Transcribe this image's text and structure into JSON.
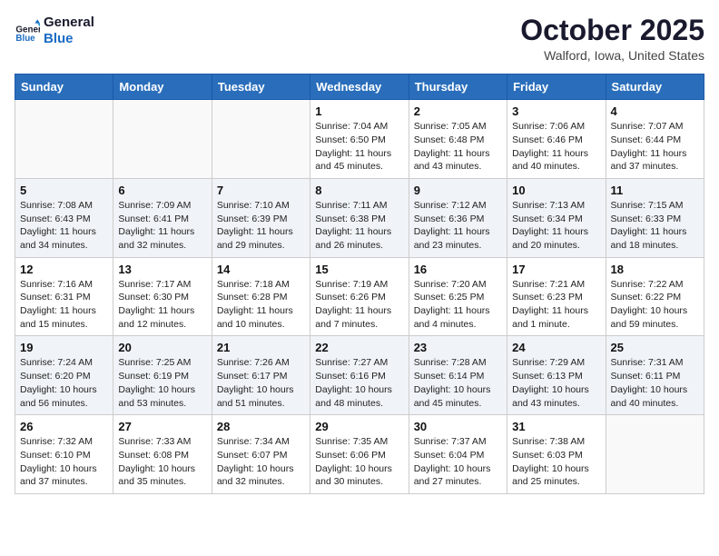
{
  "header": {
    "logo_line1": "General",
    "logo_line2": "Blue",
    "month": "October 2025",
    "location": "Walford, Iowa, United States"
  },
  "weekdays": [
    "Sunday",
    "Monday",
    "Tuesday",
    "Wednesday",
    "Thursday",
    "Friday",
    "Saturday"
  ],
  "weeks": [
    [
      {
        "day": "",
        "info": ""
      },
      {
        "day": "",
        "info": ""
      },
      {
        "day": "",
        "info": ""
      },
      {
        "day": "1",
        "info": "Sunrise: 7:04 AM\nSunset: 6:50 PM\nDaylight: 11 hours and 45 minutes."
      },
      {
        "day": "2",
        "info": "Sunrise: 7:05 AM\nSunset: 6:48 PM\nDaylight: 11 hours and 43 minutes."
      },
      {
        "day": "3",
        "info": "Sunrise: 7:06 AM\nSunset: 6:46 PM\nDaylight: 11 hours and 40 minutes."
      },
      {
        "day": "4",
        "info": "Sunrise: 7:07 AM\nSunset: 6:44 PM\nDaylight: 11 hours and 37 minutes."
      }
    ],
    [
      {
        "day": "5",
        "info": "Sunrise: 7:08 AM\nSunset: 6:43 PM\nDaylight: 11 hours and 34 minutes."
      },
      {
        "day": "6",
        "info": "Sunrise: 7:09 AM\nSunset: 6:41 PM\nDaylight: 11 hours and 32 minutes."
      },
      {
        "day": "7",
        "info": "Sunrise: 7:10 AM\nSunset: 6:39 PM\nDaylight: 11 hours and 29 minutes."
      },
      {
        "day": "8",
        "info": "Sunrise: 7:11 AM\nSunset: 6:38 PM\nDaylight: 11 hours and 26 minutes."
      },
      {
        "day": "9",
        "info": "Sunrise: 7:12 AM\nSunset: 6:36 PM\nDaylight: 11 hours and 23 minutes."
      },
      {
        "day": "10",
        "info": "Sunrise: 7:13 AM\nSunset: 6:34 PM\nDaylight: 11 hours and 20 minutes."
      },
      {
        "day": "11",
        "info": "Sunrise: 7:15 AM\nSunset: 6:33 PM\nDaylight: 11 hours and 18 minutes."
      }
    ],
    [
      {
        "day": "12",
        "info": "Sunrise: 7:16 AM\nSunset: 6:31 PM\nDaylight: 11 hours and 15 minutes."
      },
      {
        "day": "13",
        "info": "Sunrise: 7:17 AM\nSunset: 6:30 PM\nDaylight: 11 hours and 12 minutes."
      },
      {
        "day": "14",
        "info": "Sunrise: 7:18 AM\nSunset: 6:28 PM\nDaylight: 11 hours and 10 minutes."
      },
      {
        "day": "15",
        "info": "Sunrise: 7:19 AM\nSunset: 6:26 PM\nDaylight: 11 hours and 7 minutes."
      },
      {
        "day": "16",
        "info": "Sunrise: 7:20 AM\nSunset: 6:25 PM\nDaylight: 11 hours and 4 minutes."
      },
      {
        "day": "17",
        "info": "Sunrise: 7:21 AM\nSunset: 6:23 PM\nDaylight: 11 hours and 1 minute."
      },
      {
        "day": "18",
        "info": "Sunrise: 7:22 AM\nSunset: 6:22 PM\nDaylight: 10 hours and 59 minutes."
      }
    ],
    [
      {
        "day": "19",
        "info": "Sunrise: 7:24 AM\nSunset: 6:20 PM\nDaylight: 10 hours and 56 minutes."
      },
      {
        "day": "20",
        "info": "Sunrise: 7:25 AM\nSunset: 6:19 PM\nDaylight: 10 hours and 53 minutes."
      },
      {
        "day": "21",
        "info": "Sunrise: 7:26 AM\nSunset: 6:17 PM\nDaylight: 10 hours and 51 minutes."
      },
      {
        "day": "22",
        "info": "Sunrise: 7:27 AM\nSunset: 6:16 PM\nDaylight: 10 hours and 48 minutes."
      },
      {
        "day": "23",
        "info": "Sunrise: 7:28 AM\nSunset: 6:14 PM\nDaylight: 10 hours and 45 minutes."
      },
      {
        "day": "24",
        "info": "Sunrise: 7:29 AM\nSunset: 6:13 PM\nDaylight: 10 hours and 43 minutes."
      },
      {
        "day": "25",
        "info": "Sunrise: 7:31 AM\nSunset: 6:11 PM\nDaylight: 10 hours and 40 minutes."
      }
    ],
    [
      {
        "day": "26",
        "info": "Sunrise: 7:32 AM\nSunset: 6:10 PM\nDaylight: 10 hours and 37 minutes."
      },
      {
        "day": "27",
        "info": "Sunrise: 7:33 AM\nSunset: 6:08 PM\nDaylight: 10 hours and 35 minutes."
      },
      {
        "day": "28",
        "info": "Sunrise: 7:34 AM\nSunset: 6:07 PM\nDaylight: 10 hours and 32 minutes."
      },
      {
        "day": "29",
        "info": "Sunrise: 7:35 AM\nSunset: 6:06 PM\nDaylight: 10 hours and 30 minutes."
      },
      {
        "day": "30",
        "info": "Sunrise: 7:37 AM\nSunset: 6:04 PM\nDaylight: 10 hours and 27 minutes."
      },
      {
        "day": "31",
        "info": "Sunrise: 7:38 AM\nSunset: 6:03 PM\nDaylight: 10 hours and 25 minutes."
      },
      {
        "day": "",
        "info": ""
      }
    ]
  ]
}
